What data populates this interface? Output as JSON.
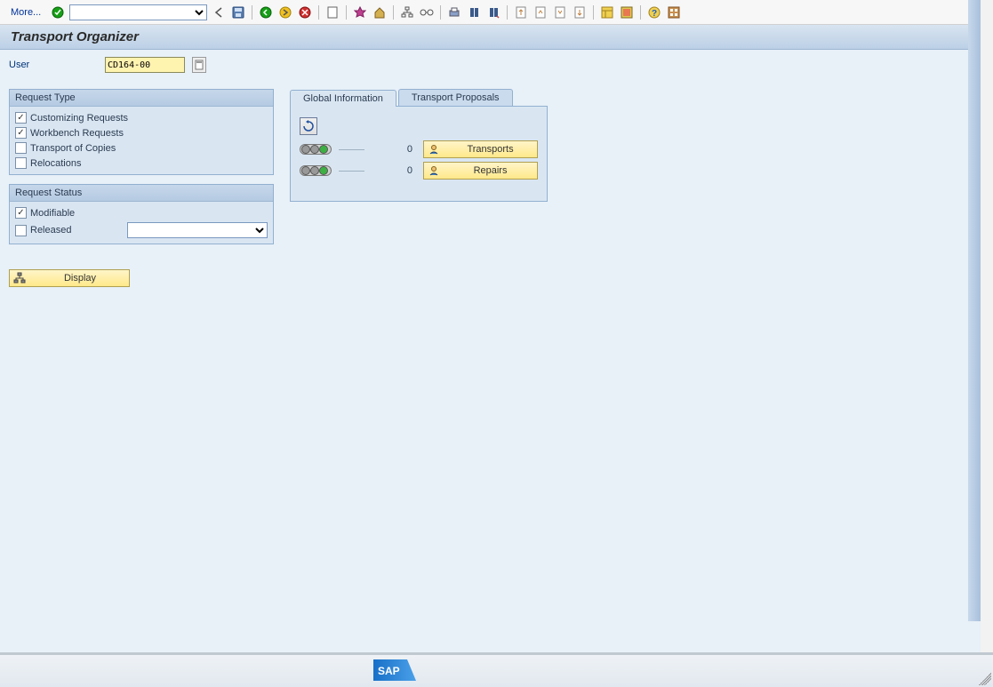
{
  "toolbar": {
    "more_label": "More..."
  },
  "title": "Transport Organizer",
  "user": {
    "label": "User",
    "value": "CD164-00"
  },
  "request_type": {
    "title": "Request Type",
    "items": [
      {
        "label": "Customizing Requests",
        "checked": true
      },
      {
        "label": "Workbench Requests",
        "checked": true
      },
      {
        "label": "Transport of Copies",
        "checked": false
      },
      {
        "label": "Relocations",
        "checked": false
      }
    ]
  },
  "request_status": {
    "title": "Request Status",
    "modifiable": {
      "label": "Modifiable",
      "checked": true
    },
    "released": {
      "label": "Released",
      "checked": false
    }
  },
  "display_button": "Display",
  "tabs": {
    "global": "Global Information",
    "proposals": "Transport Proposals"
  },
  "global_info": {
    "transports": {
      "count": "0",
      "label": "Transports"
    },
    "repairs": {
      "count": "0",
      "label": "Repairs"
    }
  },
  "sap_logo_text": "SAP"
}
